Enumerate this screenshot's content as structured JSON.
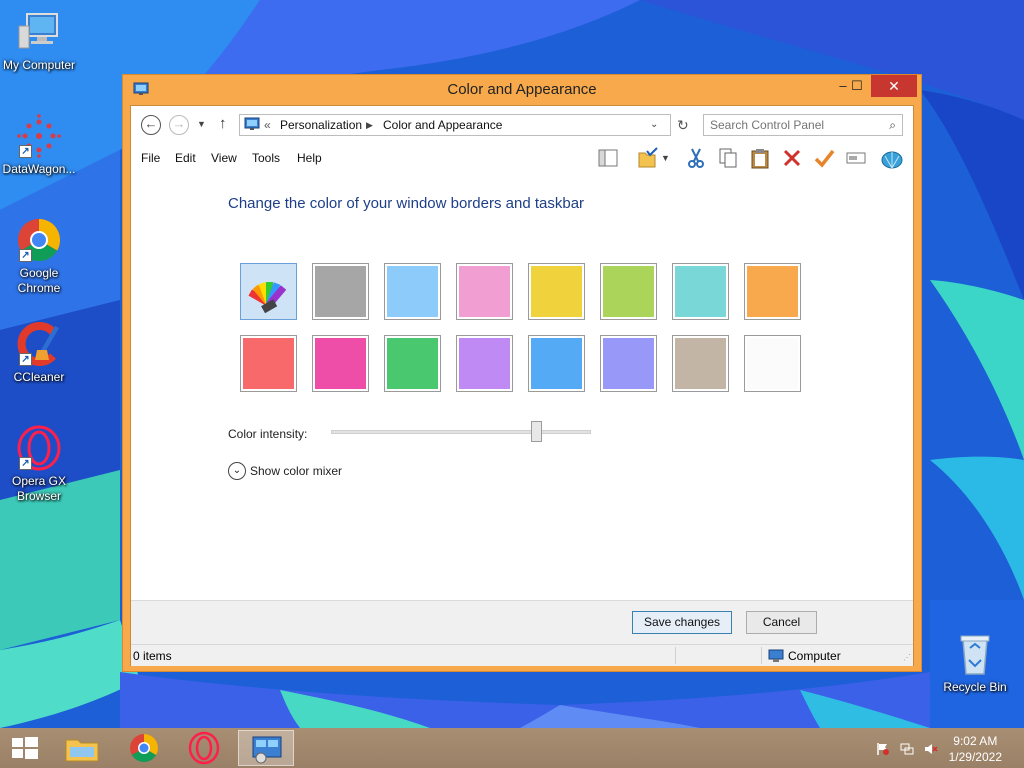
{
  "desktop": {
    "icons": [
      {
        "label": "My Computer"
      },
      {
        "label": "DataWagon..."
      },
      {
        "label": "Google Chrome"
      },
      {
        "label": "CCleaner"
      },
      {
        "label": "Opera GX Browser"
      },
      {
        "label": "Recycle Bin"
      }
    ]
  },
  "window": {
    "title": "Color and Appearance",
    "controls": {
      "minimize": "–",
      "maximize": "☐",
      "close": "✕"
    },
    "breadcrumb": {
      "overflow": "«",
      "items": [
        "Personalization",
        "Color and Appearance"
      ]
    },
    "search_placeholder": "Search Control Panel",
    "menu": [
      "File",
      "Edit",
      "View",
      "Tools",
      "Help"
    ],
    "toolbar_icons": [
      "layout-icon",
      "folder-check-icon",
      "cut-icon",
      "copy-icon",
      "paste-icon",
      "delete-icon",
      "checkmark-icon",
      "rename-icon",
      "shell-icon"
    ],
    "heading": "Change the color of your window borders and taskbar",
    "swatches": [
      {
        "name": "automatic",
        "color": "#7fb3e8",
        "selected": true
      },
      {
        "name": "gray",
        "color": "#a6a6a6"
      },
      {
        "name": "light-blue",
        "color": "#8ccbfa"
      },
      {
        "name": "pink",
        "color": "#f19fd3"
      },
      {
        "name": "yellow",
        "color": "#f0d23c"
      },
      {
        "name": "lime",
        "color": "#aad45a"
      },
      {
        "name": "teal",
        "color": "#7ad7d7"
      },
      {
        "name": "orange",
        "color": "#f8a94d"
      },
      {
        "name": "red",
        "color": "#f8696b"
      },
      {
        "name": "magenta",
        "color": "#ee4ea7"
      },
      {
        "name": "green",
        "color": "#49c86f"
      },
      {
        "name": "purple",
        "color": "#c08af4"
      },
      {
        "name": "blue",
        "color": "#55aaf5"
      },
      {
        "name": "periwinkle",
        "color": "#9898f8"
      },
      {
        "name": "taupe",
        "color": "#c2b5a6"
      },
      {
        "name": "white",
        "color": "#fbfbfb"
      }
    ],
    "intensity_label": "Color intensity:",
    "intensity_value": 0.79,
    "mixer_label": "Show color mixer",
    "buttons": {
      "save": "Save changes",
      "cancel": "Cancel"
    },
    "status": {
      "items": "0 items",
      "location": "Computer"
    }
  },
  "taskbar": {
    "time": "9:02 AM",
    "date": "1/29/2022",
    "apps": [
      "start-button",
      "file-explorer",
      "google-chrome",
      "opera-gx",
      "control-panel"
    ]
  },
  "colors": {
    "window_accent": "#f7a94b",
    "close": "#c7372f",
    "heading": "#1e3f87"
  }
}
